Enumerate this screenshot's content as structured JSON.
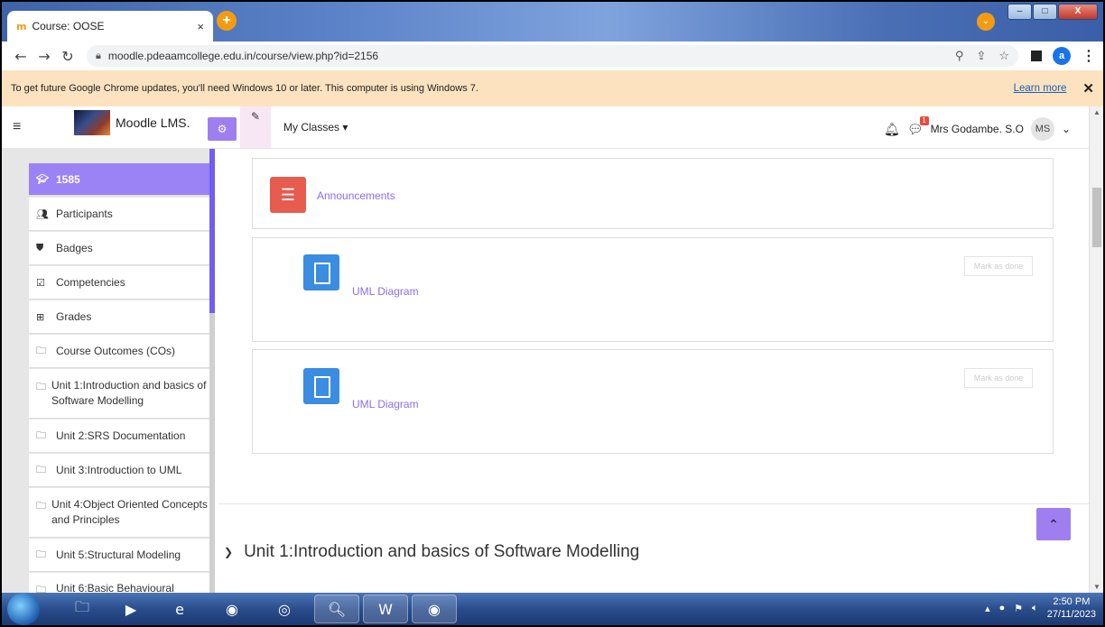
{
  "browser": {
    "tab_title": "Course: OOSE",
    "tab_favicon": "m",
    "new_tab": "+",
    "url": "moodle.pdeaamcollege.edu.in/course/view.php?id=2156",
    "profile_initial": "a",
    "window_buttons": {
      "minimize": "–",
      "maximize": "□",
      "close": "X"
    }
  },
  "infobar": {
    "message": "To get future Google Chrome updates, you'll need Windows 10 or later. This computer is using Windows 7.",
    "learn_more": "Learn more",
    "close": "✕"
  },
  "navbar": {
    "brand": "Moodle LMS.",
    "my_classes": "My Classes ▾",
    "user_name": "Mrs Godambe. S.O",
    "user_initials": "MS",
    "message_badge": "1"
  },
  "drawer": {
    "items": [
      {
        "label": "1585",
        "icon": "graduation-cap-icon",
        "active": true
      },
      {
        "label": "Participants",
        "icon": "users-icon"
      },
      {
        "label": "Badges",
        "icon": "shield-icon"
      },
      {
        "label": "Competencies",
        "icon": "checkbox-icon"
      },
      {
        "label": "Grades",
        "icon": "table-icon"
      },
      {
        "label": "Course Outcomes (COs)",
        "icon": "folder-icon"
      },
      {
        "label": "Unit 1:Introduction and basics of Software Modelling",
        "icon": "folder-icon"
      },
      {
        "label": "Unit 2:SRS Documentation",
        "icon": "folder-icon"
      },
      {
        "label": "Unit 3:Introduction to UML",
        "icon": "folder-icon"
      },
      {
        "label": "Unit 4:Object Oriented Concepts and Principles",
        "icon": "folder-icon"
      },
      {
        "label": "Unit 5:Structural Modeling",
        "icon": "folder-icon"
      },
      {
        "label": "Unit 6:Basic Behavioural",
        "icon": "folder-icon"
      }
    ]
  },
  "main": {
    "activities": [
      {
        "name": "Announcements",
        "type": "forum"
      },
      {
        "name": "UML Diagram",
        "type": "file",
        "completion": "Mark as done"
      },
      {
        "name": "UML Diagram",
        "type": "file",
        "completion": "Mark as done"
      }
    ],
    "section_title": "Unit 1:Introduction and basics of Software Modelling"
  },
  "taskbar": {
    "time": "2:50 PM",
    "date": "27/11/2023"
  },
  "colors": {
    "accent": "#9f7ef0",
    "announcement": "#e65c4f",
    "file": "#3a8de0",
    "infobar": "#fde2c0"
  }
}
